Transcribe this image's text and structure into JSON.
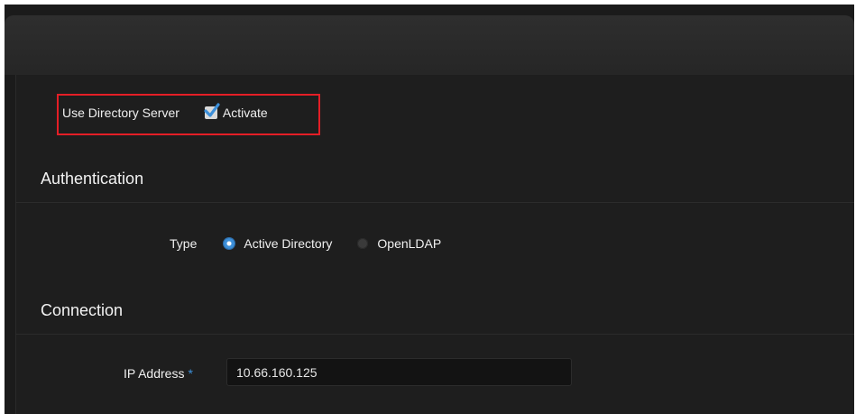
{
  "directory": {
    "label": "Use Directory Server",
    "activate_label": "Activate",
    "activate_checked": true
  },
  "authentication": {
    "title": "Authentication",
    "type_label": "Type",
    "options": [
      {
        "label": "Active Directory",
        "selected": true
      },
      {
        "label": "OpenLDAP",
        "selected": false
      }
    ]
  },
  "connection": {
    "title": "Connection",
    "ip_label": "IP Address",
    "required_mark": "*",
    "ip_value": "10.66.160.125"
  },
  "colors": {
    "accent": "#3c8fd9",
    "highlight": "#e41e26",
    "background": "#1b1b1b"
  }
}
